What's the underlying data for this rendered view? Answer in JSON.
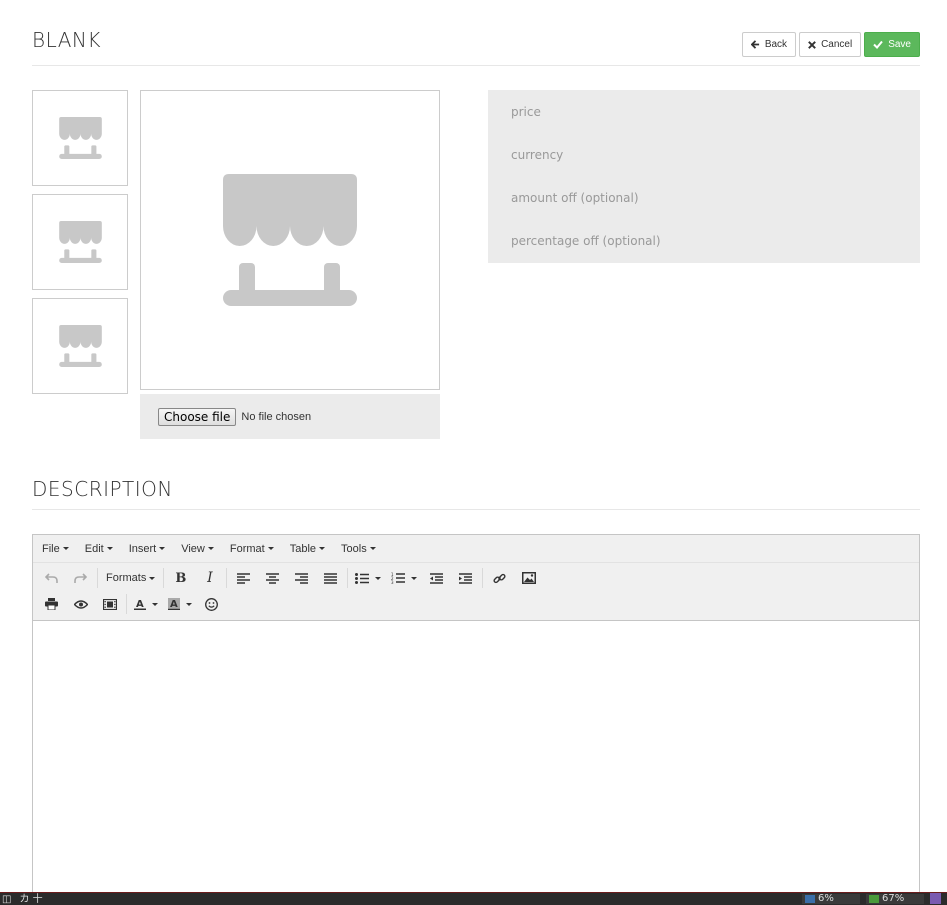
{
  "header": {
    "title": "BLANK",
    "back_label": "Back",
    "cancel_label": "Cancel",
    "save_label": "Save"
  },
  "images": {
    "thumbnail_count": 3,
    "icon": "store-awning-icon",
    "file_button_label": "Choose file",
    "file_status": "No file chosen"
  },
  "fields": {
    "price": "price",
    "currency": "currency",
    "amount_off": "amount off (optional)",
    "percentage_off": "percentage off (optional)"
  },
  "description": {
    "title": "DESCRIPTION"
  },
  "editor": {
    "menu": [
      "File",
      "Edit",
      "Insert",
      "View",
      "Format",
      "Table",
      "Tools"
    ],
    "formats_label": "Formats"
  },
  "taskbar": {
    "left_glyphs": "カ 十",
    "cpu": "6%",
    "mem": "67%"
  },
  "colors": {
    "save": "#5cb85c",
    "panel": "#ebebeb",
    "placeholder_icon": "#c8c8c8"
  }
}
